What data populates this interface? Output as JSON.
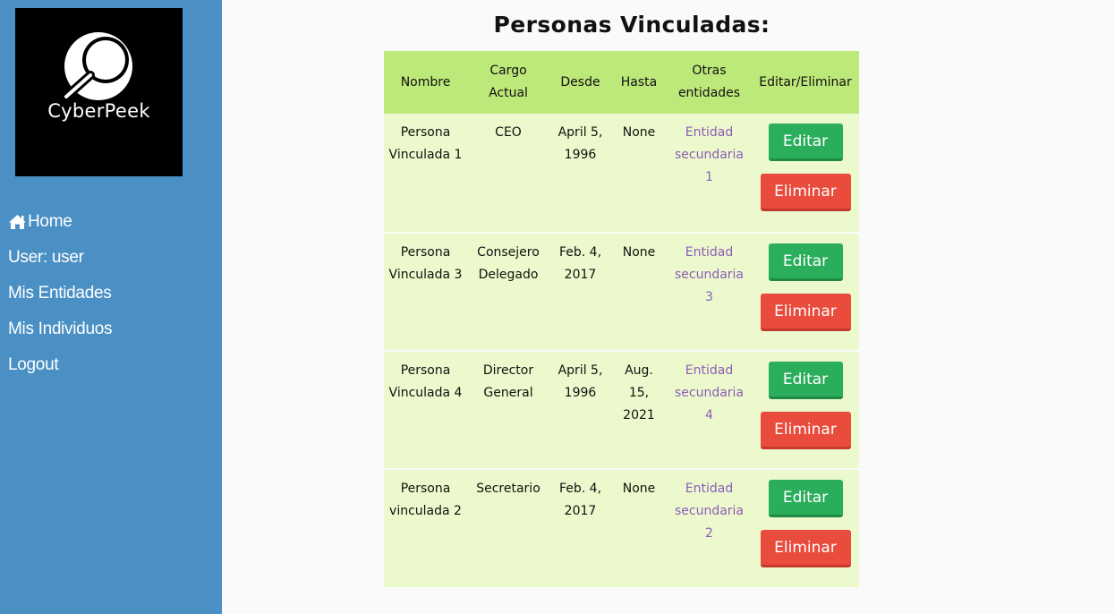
{
  "sidebar": {
    "logo_text": "CyberPeek",
    "nav": [
      {
        "label": "Home",
        "icon": "home-icon"
      },
      {
        "label": "User: user"
      },
      {
        "label": "Mis Entidades"
      },
      {
        "label": "Mis Individuos"
      },
      {
        "label": "Logout"
      }
    ]
  },
  "page": {
    "title": "Personas Vinculadas:"
  },
  "table": {
    "headers": [
      "Nombre",
      "Cargo Actual",
      "Desde",
      "Hasta",
      "Otras entidades",
      "Editar/Eliminar"
    ],
    "rows": [
      {
        "nombre": "Persona Vinculada 1",
        "cargo": "CEO",
        "desde": "April 5, 1996",
        "hasta": "None",
        "otras": "Entidad secundaria 1"
      },
      {
        "nombre": "Persona Vinculada 3",
        "cargo": "Consejero Delegado",
        "desde": "Feb. 4, 2017",
        "hasta": "None",
        "otras": "Entidad secundaria 3"
      },
      {
        "nombre": "Persona Vinculada 4",
        "cargo": "Director General",
        "desde": "April 5, 1996",
        "hasta": "Aug. 15, 2021",
        "otras": "Entidad secundaria 4"
      },
      {
        "nombre": "Persona vinculada 2",
        "cargo": "Secretario",
        "desde": "Feb. 4, 2017",
        "hasta": "None",
        "otras": "Entidad secundaria 2"
      }
    ],
    "edit_label": "Editar",
    "delete_label": "Eliminar"
  },
  "colors": {
    "sidebar": "#4a90c4",
    "header_row": "#bde87a",
    "body_row": "#ebf9cc",
    "link": "#8e5cb8",
    "edit_button": "#2bae5c",
    "delete_button": "#e94b3c"
  }
}
